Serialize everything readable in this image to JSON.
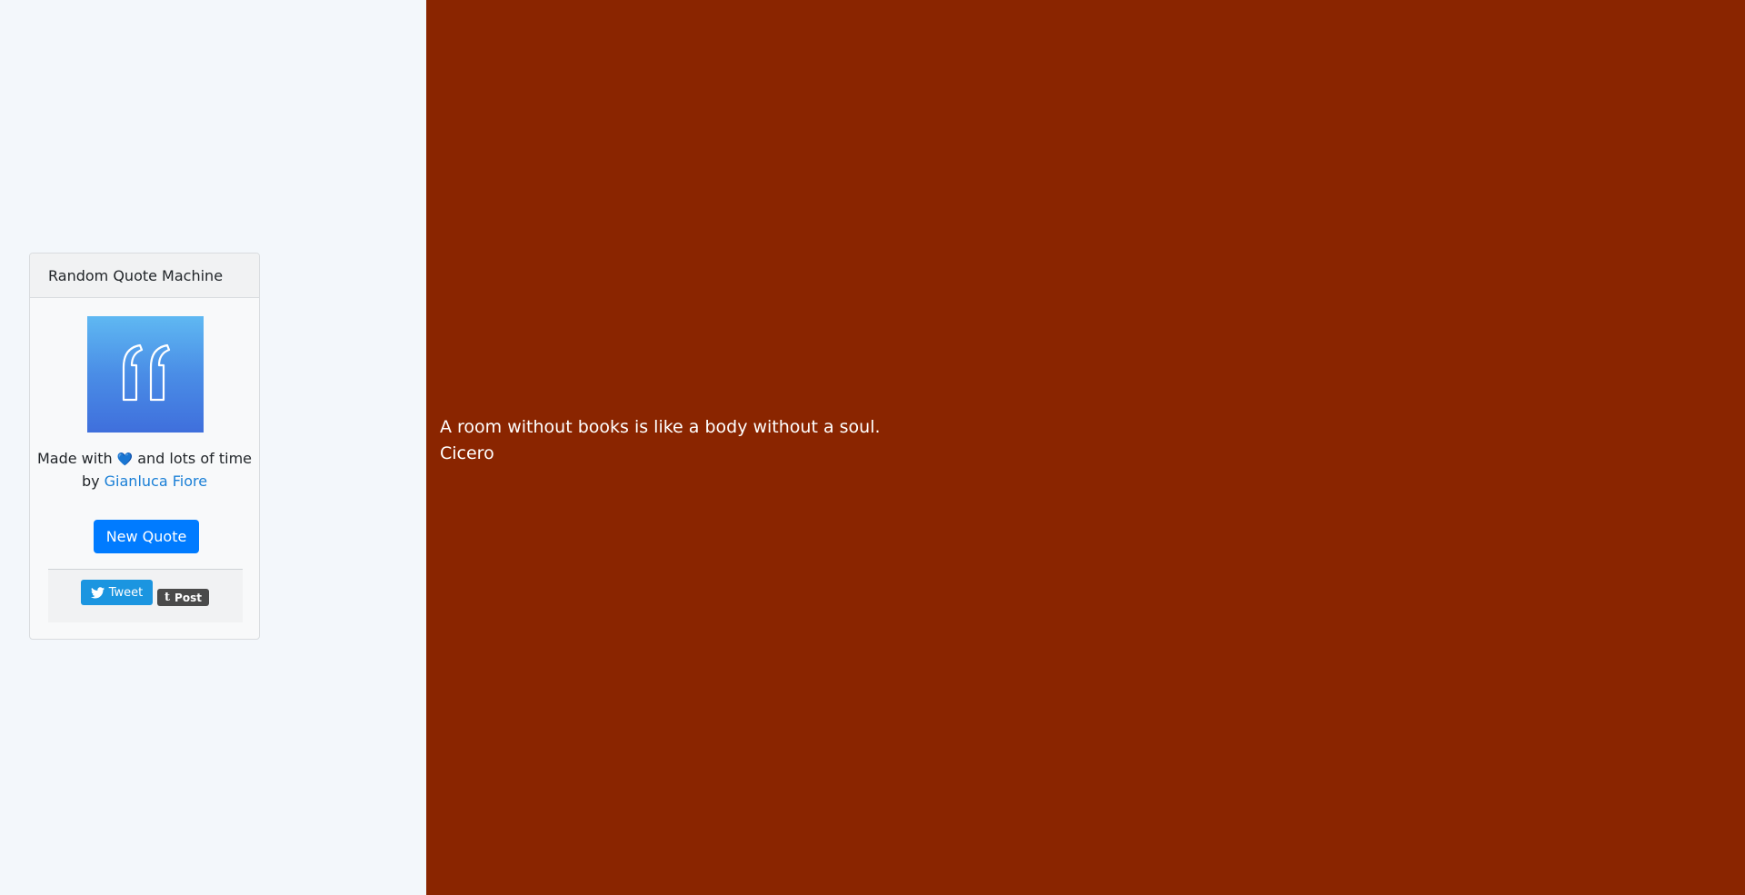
{
  "sidebar": {
    "card": {
      "title": "Random Quote Machine",
      "logo_icon": "quote-mark-icon",
      "made_with_prefix": "Made with",
      "heart_icon": "heart-icon",
      "made_with_suffix": "and lots of time by",
      "author_link": "Gianluca Fiore",
      "new_quote_label": "New Quote",
      "tweet_label": "Tweet",
      "post_label": "Post"
    }
  },
  "main": {
    "background_color": "#8a2500",
    "quote": "A room without books is like a body without a soul.",
    "author": "Cicero"
  },
  "colors": {
    "primary_button": "#007bff",
    "tweet_button": "#1b95e0",
    "tumblr_button": "#4a4a4a",
    "link": "#1a7fd6"
  }
}
